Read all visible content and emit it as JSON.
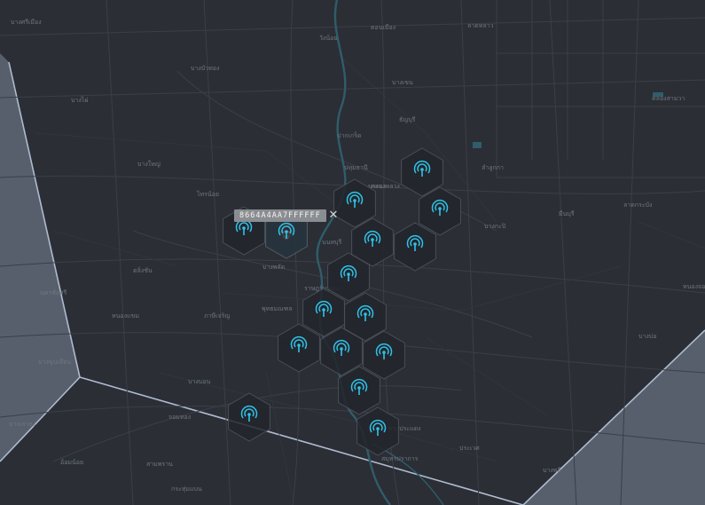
{
  "colors": {
    "background": "#2b2e35",
    "road": "#3b3f47",
    "water": "#2f5d6b",
    "region_fill": "#8d9bb0",
    "hex_fill": "#22252b",
    "hex_selected": "#4ea7bd",
    "antenna": "#2fc3e8"
  },
  "map": {
    "place_labels": [
      "บางศรีเมือง",
      "บางไผ่",
      "บางบัวทอง",
      "บางใหญ่",
      "ไทรน้อย",
      "ปทุมธานี",
      "ลำลูกกา",
      "ธัญบุรี",
      "คลองหลวง",
      "นนทบุรี",
      "ปากเกร็ด",
      "บางเขน",
      "ดอนเมือง",
      "ลาดหลาว",
      "บางกะปิ",
      "มีนบุรี",
      "ลาดกระบัง",
      "ตลิ่งชัน",
      "บางพลัด",
      "ภาษีเจริญ",
      "หนองแขม",
      "บางบอน",
      "จอมทอง",
      "ราษฎร์บูรณะ",
      "พระประแดง",
      "บางนา",
      "ประเวศ",
      "บางพลี",
      "สมุทรปราการ",
      "กระทุ่มแบน",
      "สามพราน",
      "นครชัยศรี",
      "พุทธมณฑล",
      "อ้อมน้อย",
      "บางขุนเทียน",
      "บางบ่อ",
      "บางเสาธง",
      "หนองจอก",
      "คลองสามวา",
      "วังน้อย"
    ]
  },
  "hexagons": [
    {
      "id": "h1",
      "selected": false
    },
    {
      "id": "h2",
      "selected": false
    },
    {
      "id": "h3",
      "selected": false
    },
    {
      "id": "h4",
      "selected": false
    },
    {
      "id": "h5",
      "selected": false
    },
    {
      "id": "h6",
      "selected": true
    },
    {
      "id": "h7",
      "selected": false
    },
    {
      "id": "h8",
      "selected": false
    },
    {
      "id": "h9",
      "selected": false
    },
    {
      "id": "h10",
      "selected": false
    },
    {
      "id": "h11",
      "selected": false
    },
    {
      "id": "h12",
      "selected": false
    },
    {
      "id": "h13",
      "selected": false
    },
    {
      "id": "h14",
      "selected": false
    },
    {
      "id": "h15",
      "selected": false
    },
    {
      "id": "h16",
      "selected": false
    },
    {
      "id": "h17",
      "selected": false
    }
  ],
  "popup": {
    "cell_id": "8664A4AA7FFFFFF",
    "close_symbol": "✕",
    "marker_icon": "santa-icon"
  }
}
